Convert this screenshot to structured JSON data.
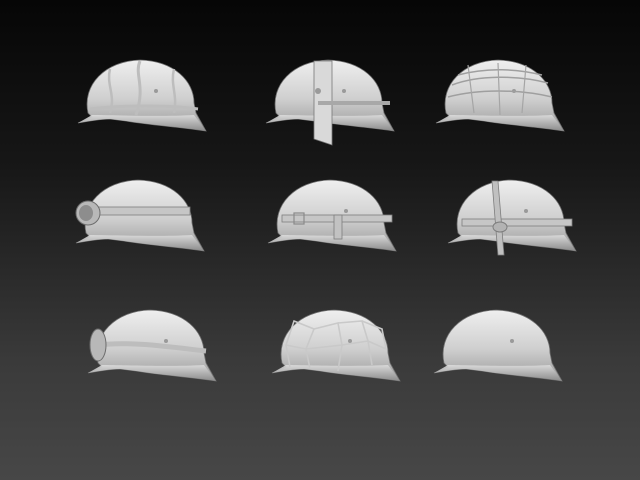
{
  "scene": {
    "background_top": "#060606",
    "background_bottom": "#474747",
    "helmet_color": "#d6d6d6",
    "helmet_shadow": "#8f8f8f"
  },
  "helmets": [
    {
      "id": "wire-wrapped",
      "accessory": "wire"
    },
    {
      "id": "visor-plate",
      "accessory": "visor"
    },
    {
      "id": "cloth-cover",
      "accessory": "cover"
    },
    {
      "id": "goggles-front",
      "accessory": "goggles"
    },
    {
      "id": "strap-buckle",
      "accessory": "strap"
    },
    {
      "id": "chinstrap-vertical",
      "accessory": "chinstrap"
    },
    {
      "id": "goggles-side",
      "accessory": "goggles2"
    },
    {
      "id": "net-cover",
      "accessory": "net"
    },
    {
      "id": "plain",
      "accessory": "none"
    }
  ]
}
